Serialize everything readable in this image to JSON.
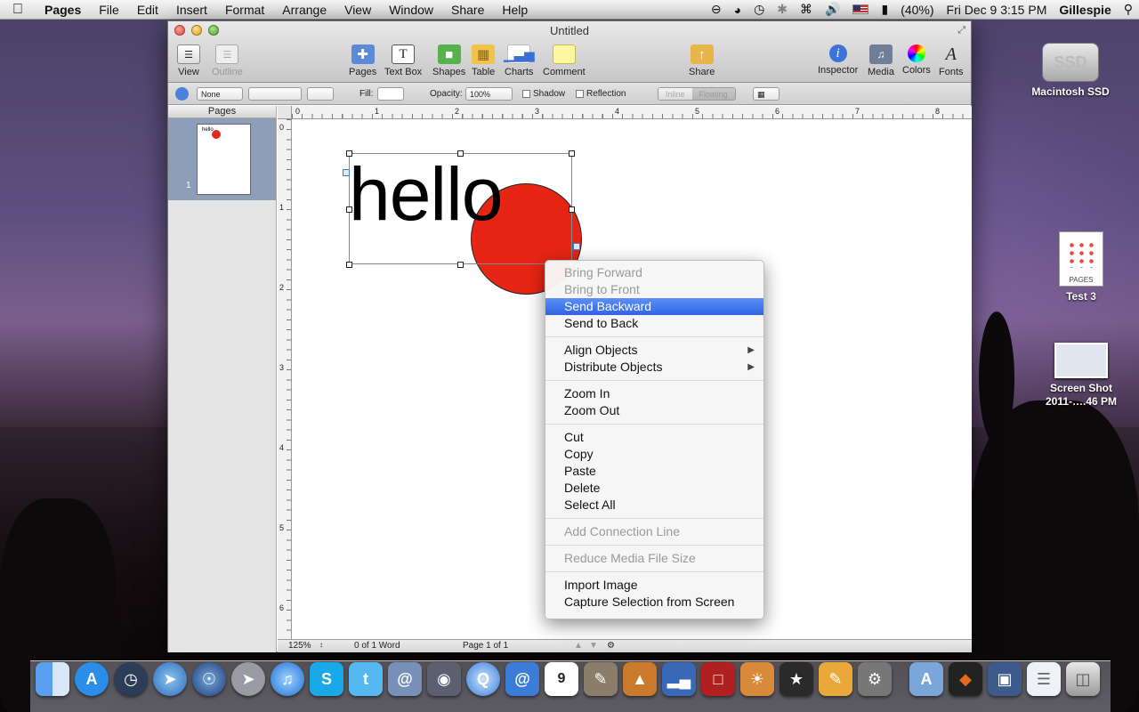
{
  "menubar": {
    "app_name": "Pages",
    "items": [
      "File",
      "Edit",
      "Insert",
      "Format",
      "Arrange",
      "View",
      "Window",
      "Share",
      "Help"
    ],
    "battery": "(40%)",
    "clock": "Fri Dec 9  3:15 PM",
    "user": "Gillespie"
  },
  "window": {
    "title": "Untitled",
    "toolbar": {
      "view": "View",
      "outline": "Outline",
      "pages": "Pages",
      "textbox": "Text Box",
      "shapes": "Shapes",
      "table": "Table",
      "charts": "Charts",
      "comment": "Comment",
      "share": "Share",
      "inspector": "Inspector",
      "media": "Media",
      "colors": "Colors",
      "fonts": "Fonts"
    },
    "formatbar": {
      "stroke_style": "None",
      "fill_label": "Fill:",
      "opacity_label": "Opacity:",
      "opacity_value": "100%",
      "shadow_label": "Shadow",
      "reflection_label": "Reflection",
      "inline_label": "Inline",
      "floating_label": "Floating"
    },
    "sidebar": {
      "header": "Pages",
      "thumb_text": "hello",
      "page_number": "1"
    },
    "ruler": {
      "h_marks": [
        "0",
        "1",
        "2",
        "3",
        "4",
        "5",
        "6",
        "7",
        "8"
      ],
      "v_marks": [
        "0",
        "1",
        "2",
        "3",
        "4",
        "5",
        "6"
      ]
    },
    "canvas": {
      "text": "hello",
      "circle_color": "#e72514"
    },
    "status": {
      "zoom": "125%",
      "word_count": "0 of 1 Word",
      "page": "Page 1 of 1"
    }
  },
  "context_menu": {
    "groups": [
      [
        {
          "label": "Bring Forward",
          "disabled": true
        },
        {
          "label": "Bring to Front",
          "disabled": true
        },
        {
          "label": "Send Backward",
          "selected": true
        },
        {
          "label": "Send to Back"
        }
      ],
      [
        {
          "label": "Align Objects",
          "submenu": true
        },
        {
          "label": "Distribute Objects",
          "submenu": true
        }
      ],
      [
        {
          "label": "Zoom In"
        },
        {
          "label": "Zoom Out"
        }
      ],
      [
        {
          "label": "Cut"
        },
        {
          "label": "Copy"
        },
        {
          "label": "Paste"
        },
        {
          "label": "Delete"
        },
        {
          "label": "Select All"
        }
      ],
      [
        {
          "label": "Add Connection Line",
          "disabled": true
        }
      ],
      [
        {
          "label": "Reduce Media File Size",
          "disabled": true
        }
      ],
      [
        {
          "label": "Import Image"
        },
        {
          "label": "Capture Selection from Screen"
        }
      ]
    ]
  },
  "desktop": {
    "drive_label": "Macintosh SSD",
    "drive_text": "SSD",
    "doc_label": "Test 3",
    "doc_badge": "PAGES",
    "shot_label_line1": "Screen Shot",
    "shot_label_line2": "2011-….46 PM"
  },
  "dock": {
    "items": [
      "finder",
      "app-store",
      "dashboard",
      "safari",
      "network",
      "launchpad",
      "itunes",
      "skype",
      "twitter",
      "mail-stamp",
      "facetime",
      "quicktime",
      "address-book",
      "calendar",
      "dictionary",
      "preview",
      "keynote",
      "numbers",
      "photo-booth",
      "iphoto",
      "imovie",
      "pages",
      "system-preferences",
      "applications-folder",
      "adobe",
      "screenshot",
      "documents",
      "trash"
    ],
    "calendar_day": "9"
  }
}
